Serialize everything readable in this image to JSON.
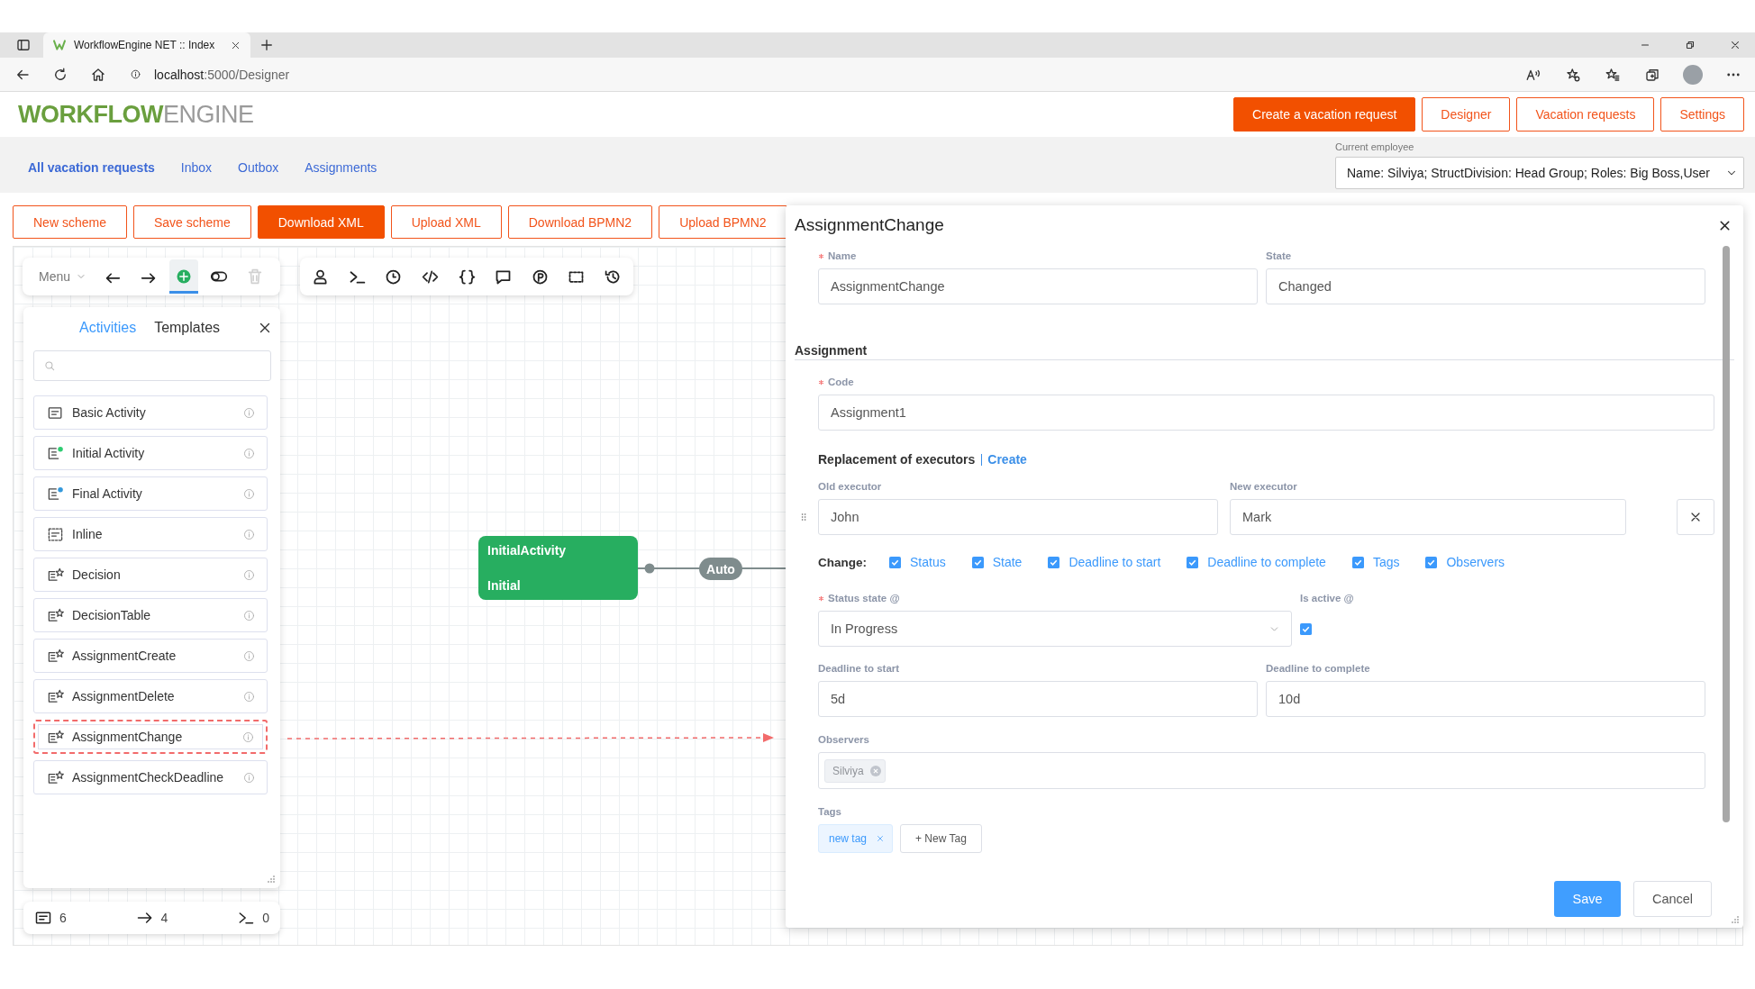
{
  "browser": {
    "tab_title": "WorkflowEngine NET :: Index",
    "url": {
      "host": "localhost",
      "path": ":5000/Designer"
    }
  },
  "header": {
    "logo": {
      "strong": "WORKFLOW",
      "light": "ENGINE"
    },
    "buttons": [
      {
        "label": "Create a vacation request",
        "primary": true
      },
      {
        "label": "Designer",
        "primary": false
      },
      {
        "label": "Vacation requests",
        "primary": false
      },
      {
        "label": "Settings",
        "primary": false
      }
    ]
  },
  "nav": {
    "links": [
      {
        "label": "All vacation requests",
        "selected": true
      },
      {
        "label": "Inbox",
        "selected": false
      },
      {
        "label": "Outbox",
        "selected": false
      },
      {
        "label": "Assignments",
        "selected": false
      }
    ],
    "employee_label": "Current employee",
    "employee_value": "Name: Silviya; StructDivision: Head Group; Roles: Big Boss,User"
  },
  "scheme_buttons": [
    {
      "label": "New scheme",
      "primary": false
    },
    {
      "label": "Save scheme",
      "primary": false
    },
    {
      "label": "Download XML",
      "primary": true
    },
    {
      "label": "Upload XML",
      "primary": false
    },
    {
      "label": "Download BPMN2",
      "primary": false
    },
    {
      "label": "Upload BPMN2",
      "primary": false
    }
  ],
  "toolbar": {
    "menu_label": "Menu",
    "tools": [
      {
        "kind": "undo",
        "selected": false,
        "disabled": false
      },
      {
        "kind": "redo",
        "selected": false,
        "disabled": false
      },
      {
        "kind": "add",
        "selected": true,
        "disabled": false
      },
      {
        "kind": "toggle",
        "selected": false,
        "disabled": false
      },
      {
        "kind": "delete",
        "selected": false,
        "disabled": true
      }
    ]
  },
  "element_toolbar": [
    {
      "kind": "person"
    },
    {
      "kind": "terminal"
    },
    {
      "kind": "clock"
    },
    {
      "kind": "code"
    },
    {
      "kind": "braces"
    },
    {
      "kind": "comment"
    },
    {
      "kind": "parameter"
    },
    {
      "kind": "selection"
    },
    {
      "kind": "history"
    }
  ],
  "panel": {
    "tabs": [
      {
        "label": "Activities",
        "selected": true
      },
      {
        "label": "Templates",
        "selected": false
      }
    ],
    "items": [
      {
        "label": "Basic Activity",
        "kind": "basic",
        "selected": false
      },
      {
        "label": "Initial Activity",
        "kind": "initial",
        "selected": false
      },
      {
        "label": "Final Activity",
        "kind": "final",
        "selected": false
      },
      {
        "label": "Inline",
        "kind": "inline",
        "selected": false
      },
      {
        "label": "Decision",
        "kind": "custom",
        "selected": false
      },
      {
        "label": "DecisionTable",
        "kind": "custom",
        "selected": false
      },
      {
        "label": "AssignmentCreate",
        "kind": "custom",
        "selected": false
      },
      {
        "label": "AssignmentDelete",
        "kind": "custom",
        "selected": false
      },
      {
        "label": "AssignmentChange",
        "kind": "custom",
        "selected": true
      },
      {
        "label": "AssignmentCheckDeadline",
        "kind": "custom",
        "selected": false
      }
    ]
  },
  "counters": [
    {
      "kind": "activities",
      "value": "6"
    },
    {
      "kind": "transitions",
      "value": "4"
    },
    {
      "kind": "commands",
      "value": "0"
    }
  ],
  "canvas": {
    "node": {
      "title": "InitialActivity",
      "state": "Initial"
    },
    "transition_label": "Auto"
  },
  "dialog": {
    "title": "AssignmentChange",
    "name": {
      "label": "Name",
      "required": true,
      "value": "AssignmentChange"
    },
    "state": {
      "label": "State",
      "value": "Changed"
    },
    "section": "Assignment",
    "code": {
      "label": "Code",
      "required": true,
      "value": "Assignment1"
    },
    "replacement": {
      "label": "Replacement of executors",
      "link": "Create"
    },
    "old_executor": {
      "label": "Old executor",
      "value": "John"
    },
    "new_executor": {
      "label": "New executor",
      "value": "Mark"
    },
    "change_label": "Change:",
    "change_options": [
      {
        "label": "Status",
        "checked": true
      },
      {
        "label": "State",
        "checked": true
      },
      {
        "label": "Deadline to start",
        "checked": true
      },
      {
        "label": "Deadline to complete",
        "checked": true
      },
      {
        "label": "Tags",
        "checked": true
      },
      {
        "label": "Observers",
        "checked": true
      }
    ],
    "status_state": {
      "label": "Status state @",
      "required": true,
      "value": "In Progress"
    },
    "is_active": {
      "label": "Is active @",
      "checked": true
    },
    "deadline_start": {
      "label": "Deadline to start",
      "value": "5d"
    },
    "deadline_complete": {
      "label": "Deadline to complete",
      "value": "10d"
    },
    "observers": {
      "label": "Observers",
      "chips": [
        "Silviya"
      ]
    },
    "tags": {
      "label": "Tags",
      "items": [
        "new tag"
      ],
      "add_label": "+ New Tag"
    },
    "buttons": {
      "save": "Save",
      "cancel": "Cancel"
    }
  }
}
